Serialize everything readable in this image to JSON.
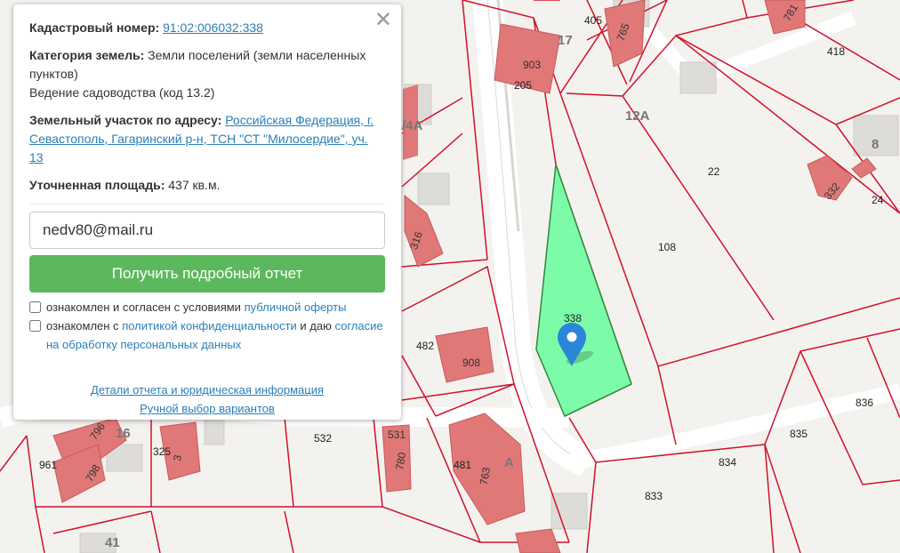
{
  "popup": {
    "close_label": "✕",
    "cadastral_label": "Кадастровый номер:",
    "cadastral_value": "91:02:006032:338",
    "category_label": "Категория земель:",
    "category_value": "Земли поселений (земли населенных пунктов)",
    "use_value": "Ведение садоводства (код 13.2)",
    "address_label": "Земельный участок по адресу:",
    "address_value": "Российская Федерация, г. Севастополь, Гагаринский р-н, ТСН \"СТ \"Милосердие\", уч. 13",
    "area_label": "Уточненная площадь:",
    "area_value": "437 кв.м.",
    "email_value": "nedv80@mail.ru",
    "submit_label": "Получить подробный отчет",
    "consent1_text": "ознакомлен и согласен с условиями ",
    "consent1_link": "публичной оферты",
    "consent2_text": "ознакомлен с ",
    "consent2_link": "политикой конфиденциальности",
    "consent2_mid": " и даю ",
    "consent2_link2": "согласие на обработку персональных данных",
    "details_link": "Детали отчета и юридическая информация",
    "manual_link": "Ручной выбор вариантов"
  },
  "map": {
    "selected_plot": "338",
    "plot_labels": [
      "418",
      "22",
      "24",
      "108",
      "836",
      "835",
      "834",
      "833",
      "532",
      "482",
      "481",
      "961",
      "325",
      "405",
      "205"
    ],
    "building_labels": [
      "781",
      "765",
      "903",
      "332",
      "316",
      "908",
      "531",
      "780",
      "763",
      "798",
      "796",
      "3"
    ],
    "quarter_labels": [
      "12А",
      "17",
      "8",
      "/4А",
      "А",
      "41",
      "16"
    ],
    "colors": {
      "plot_border": "#d0122b",
      "building": "#e07878",
      "selected": "#7cfba8",
      "marker": "#2a86d8"
    }
  }
}
